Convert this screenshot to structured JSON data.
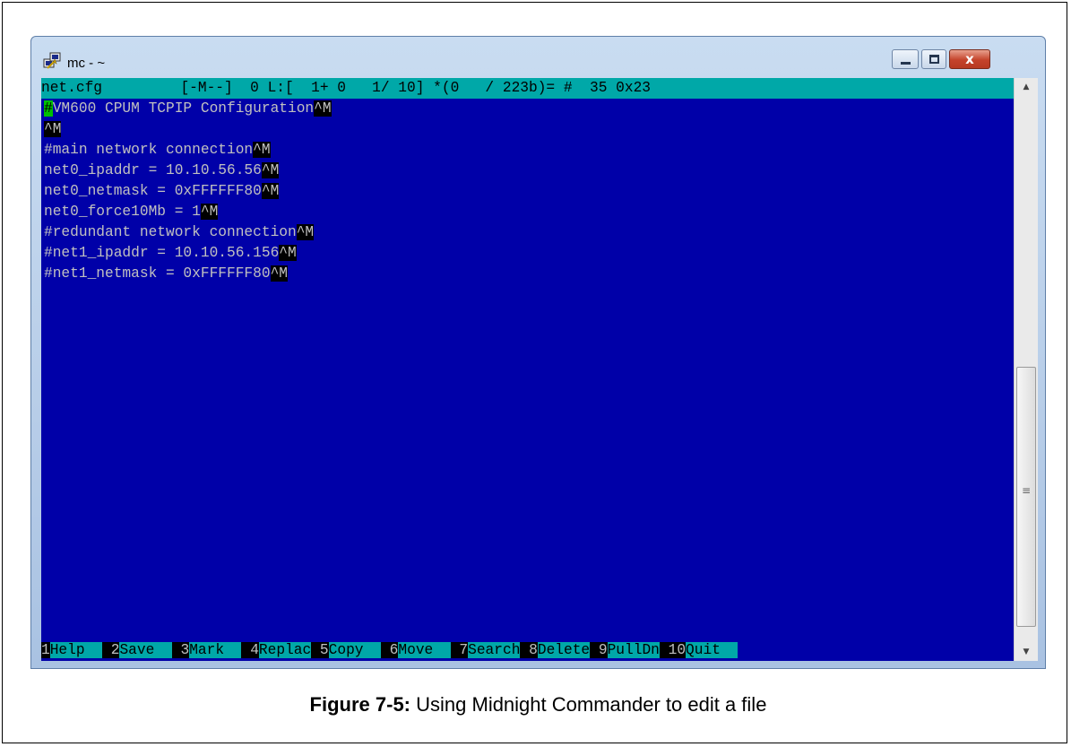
{
  "window": {
    "title": "mc - ~",
    "icons": {
      "app": "putty-icon",
      "minimize": "minimize-icon",
      "maximize": "maximize-icon",
      "close": "close-icon"
    },
    "close_glyph": "x"
  },
  "editor": {
    "status": {
      "filename": "net.cfg",
      "info": "[-M--]  0 L:[  1+ 0   1/ 10] *(0   / 223b)= #  35 0x23"
    },
    "lines": [
      {
        "cursor": "#",
        "text": "VM600 CPUM TCPIP Configuration",
        "eol": "^M"
      },
      {
        "text": "",
        "eol": "^M"
      },
      {
        "text": "#main network connection",
        "eol": "^M"
      },
      {
        "text": "net0_ipaddr = 10.10.56.56",
        "eol": "^M"
      },
      {
        "text": "net0_netmask = 0xFFFFFF80",
        "eol": "^M"
      },
      {
        "text": "net0_force10Mb = 1",
        "eol": "^M"
      },
      {
        "text": "#redundant network connection",
        "eol": "^M"
      },
      {
        "text": "#net1_ipaddr = 10.10.56.156",
        "eol": "^M"
      },
      {
        "text": "#net1_netmask = 0xFFFFFF80",
        "eol": "^M"
      }
    ],
    "function_keys": [
      {
        "num": "1",
        "label": "Help  "
      },
      {
        "num": " 2",
        "label": "Save  "
      },
      {
        "num": " 3",
        "label": "Mark  "
      },
      {
        "num": " 4",
        "label": "Replac"
      },
      {
        "num": " 5",
        "label": "Copy  "
      },
      {
        "num": " 6",
        "label": "Move  "
      },
      {
        "num": " 7",
        "label": "Search"
      },
      {
        "num": " 8",
        "label": "Delete"
      },
      {
        "num": " 9",
        "label": "PullDn"
      },
      {
        "num": " 10",
        "label": "Quit  "
      }
    ],
    "colors": {
      "background": "#0000a8",
      "status_bar": "#00a8a8",
      "cursor": "#00c000",
      "text": "#c0c0c0"
    }
  },
  "scrollbar": {
    "up_icon": "scroll-up-arrow-icon",
    "down_icon": "scroll-down-arrow-icon",
    "grip": "≡"
  },
  "caption": {
    "label": "Figure 7-5:",
    "text": " Using Midnight Commander to edit a file"
  }
}
